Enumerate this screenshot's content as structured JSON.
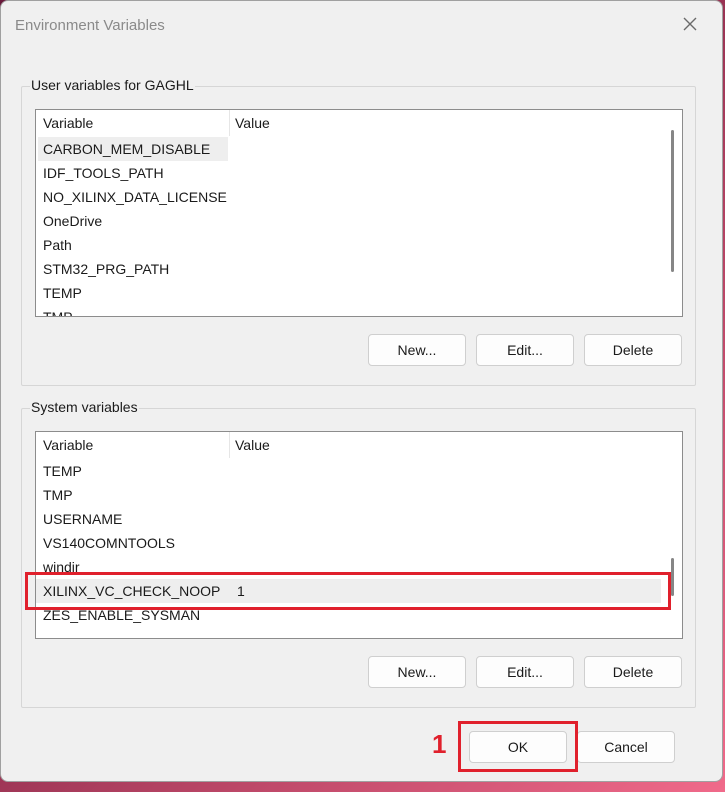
{
  "window": {
    "title": "Environment Variables",
    "close_icon": "close-icon"
  },
  "user_section": {
    "label": "User variables for GAGHL",
    "columns": [
      "Variable",
      "Value"
    ],
    "rows": [
      {
        "variable": "CARBON_MEM_DISABLE",
        "value": ""
      },
      {
        "variable": "IDF_TOOLS_PATH",
        "value": ""
      },
      {
        "variable": "NO_XILINX_DATA_LICENSE",
        "value": ""
      },
      {
        "variable": "OneDrive",
        "value": ""
      },
      {
        "variable": "Path",
        "value": ""
      },
      {
        "variable": "STM32_PRG_PATH",
        "value": ""
      },
      {
        "variable": "TEMP",
        "value": ""
      },
      {
        "variable": "TMP",
        "value": ""
      }
    ],
    "buttons": {
      "new": "New...",
      "edit": "Edit...",
      "delete": "Delete"
    }
  },
  "system_section": {
    "label": "System variables",
    "columns": [
      "Variable",
      "Value"
    ],
    "rows": [
      {
        "variable": "TEMP",
        "value": ""
      },
      {
        "variable": "TMP",
        "value": ""
      },
      {
        "variable": "USERNAME",
        "value": ""
      },
      {
        "variable": "VS140COMNTOOLS",
        "value": ""
      },
      {
        "variable": "windir",
        "value": ""
      },
      {
        "variable": "XILINX_VC_CHECK_NOOP",
        "value": "1"
      },
      {
        "variable": "ZES_ENABLE_SYSMAN",
        "value": ""
      }
    ],
    "buttons": {
      "new": "New...",
      "edit": "Edit...",
      "delete": "Delete"
    }
  },
  "footer": {
    "ok": "OK",
    "cancel": "Cancel"
  },
  "annotation": {
    "step_number": "1",
    "color": "#e0202c"
  }
}
